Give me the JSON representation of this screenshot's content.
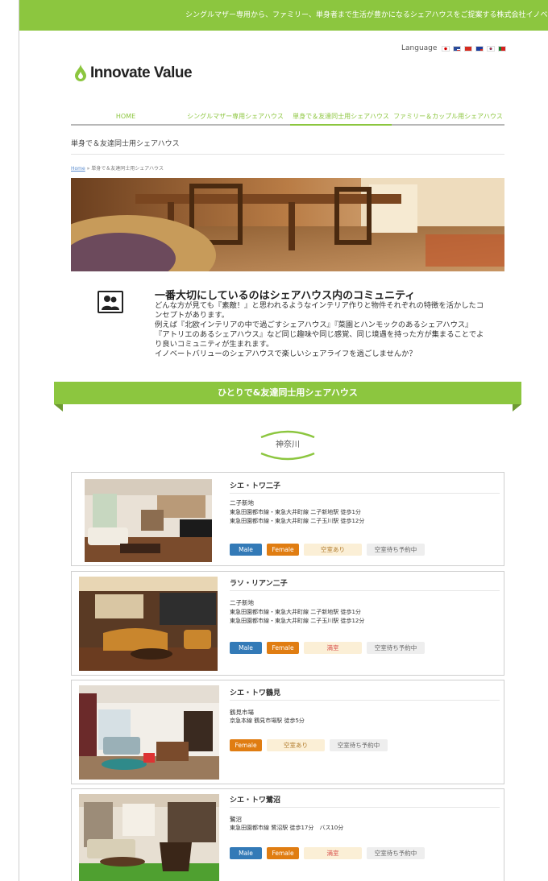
{
  "header": {
    "tagline": "シングルマザー専用から、ファミリー、単身者まで生活が豊かになるシェアハウスをご提案する株式会社イノベートバリュー",
    "language_label": "Language",
    "flags": [
      "jp",
      "us",
      "cn",
      "tw",
      "kr",
      "pt"
    ],
    "logo_text": "Innovate Value",
    "brand_color": "#8cc63f"
  },
  "nav": {
    "items": [
      {
        "label": "HOME"
      },
      {
        "label": "シングルマザー専用シェアハウス"
      },
      {
        "label": "単身で＆友達同士用シェアハウス"
      },
      {
        "label": "ファミリー＆カップル用シェアハウス"
      }
    ],
    "active_index": 2
  },
  "page": {
    "title": "単身で＆友達同士用シェアハウス",
    "breadcrumb_home": "Home",
    "breadcrumb_sep": " » ",
    "breadcrumb_current": "単身で＆友達同士用シェアハウス"
  },
  "intro": {
    "icon": "community-icon",
    "title": "一番大切にしているのはシェアハウス内のコミュニティ",
    "lines": [
      "どんな方が見ても『素敵！』と思われるようなインテリア作りと物件それぞれの特徴を活かしたコ",
      "ンセプトがあります。",
      "例えば『北欧インテリアの中で過ごすシェアハウス』『菜園とハンモックのあるシェアハウス』",
      "『アトリエのあるシェアハウス』など同じ趣味や同じ感覚、同じ境遇を持った方が集まることでよ",
      "り良いコミュニティが生まれます。",
      "イノベートバリューのシェアハウスで楽しいシェアライフを過ごしませんか？"
    ]
  },
  "section": {
    "banner": "ひとりで&友達同士用シェアハウス",
    "region": "神奈川"
  },
  "properties": [
    {
      "name": "シエ・トワ二子",
      "area": "二子新地",
      "access": [
        "東急田園都市線・東急大井町線 二子新地駅 徒歩1分",
        "東急田園都市線・東急大井町線 二子玉川駅 徒歩12分"
      ],
      "tags": [
        {
          "text": "Male",
          "kind": "male"
        },
        {
          "text": "Female",
          "kind": "female"
        },
        {
          "text": "空室あり",
          "kind": "vacant"
        },
        {
          "text": "空室待ち予約中",
          "kind": "wait"
        }
      ]
    },
    {
      "name": "ラソ・リアン二子",
      "area": "二子新地",
      "access": [
        "東急田園都市線・東急大井町線 二子新地駅 徒歩1分",
        "東急田園都市線・東急大井町線 二子玉川駅 徒歩12分"
      ],
      "tags": [
        {
          "text": "Male",
          "kind": "male"
        },
        {
          "text": "Female",
          "kind": "female"
        },
        {
          "text": "満室",
          "kind": "full"
        },
        {
          "text": "空室待ち予約中",
          "kind": "wait"
        }
      ]
    },
    {
      "name": "シエ・トワ鶴見",
      "area": "鶴見市場",
      "access": [
        "京急本線 鶴見市場駅 徒歩5分"
      ],
      "tags": [
        {
          "text": "Female",
          "kind": "female"
        },
        {
          "text": "空室あり",
          "kind": "vacant"
        },
        {
          "text": "空室待ち予約中",
          "kind": "wait"
        }
      ]
    },
    {
      "name": "シエ・トワ鷺沼",
      "area": "鷺沼",
      "access": [
        "東急田園都市線 鷺沼駅 徒歩17分　バス10分"
      ],
      "tags": [
        {
          "text": "Male",
          "kind": "male"
        },
        {
          "text": "Female",
          "kind": "female"
        },
        {
          "text": "満室",
          "kind": "full"
        },
        {
          "text": "空室待ち予約中",
          "kind": "wait"
        }
      ]
    }
  ]
}
